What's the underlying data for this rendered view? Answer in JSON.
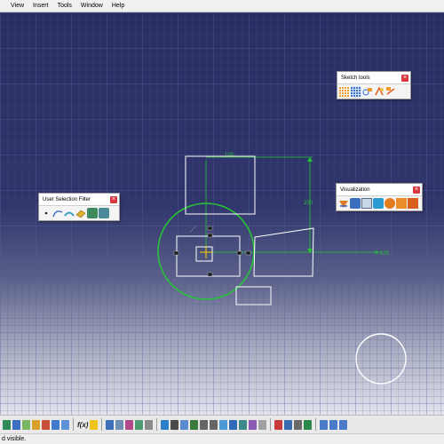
{
  "menu": {
    "items": [
      "View",
      "Insert",
      "Tools",
      "Window",
      "Help"
    ]
  },
  "panels": {
    "sketch_tools": {
      "title": "Sketch tools",
      "close": "×"
    },
    "user_selection_filter": {
      "title": "User Selection Filter",
      "close": "×"
    },
    "visualization": {
      "title": "Visualization",
      "close": "×"
    }
  },
  "sketch": {
    "dim_width": "100",
    "dim_height": "200",
    "dim_radius": "R 100"
  },
  "taskbar": {
    "formula_label": "f(x)"
  },
  "status": {
    "text": "d visible."
  },
  "colors": {
    "background_top": "#2a2e63",
    "grid": "#4b5090",
    "geometry": "#ffffff",
    "constraint": "#27c43a"
  }
}
